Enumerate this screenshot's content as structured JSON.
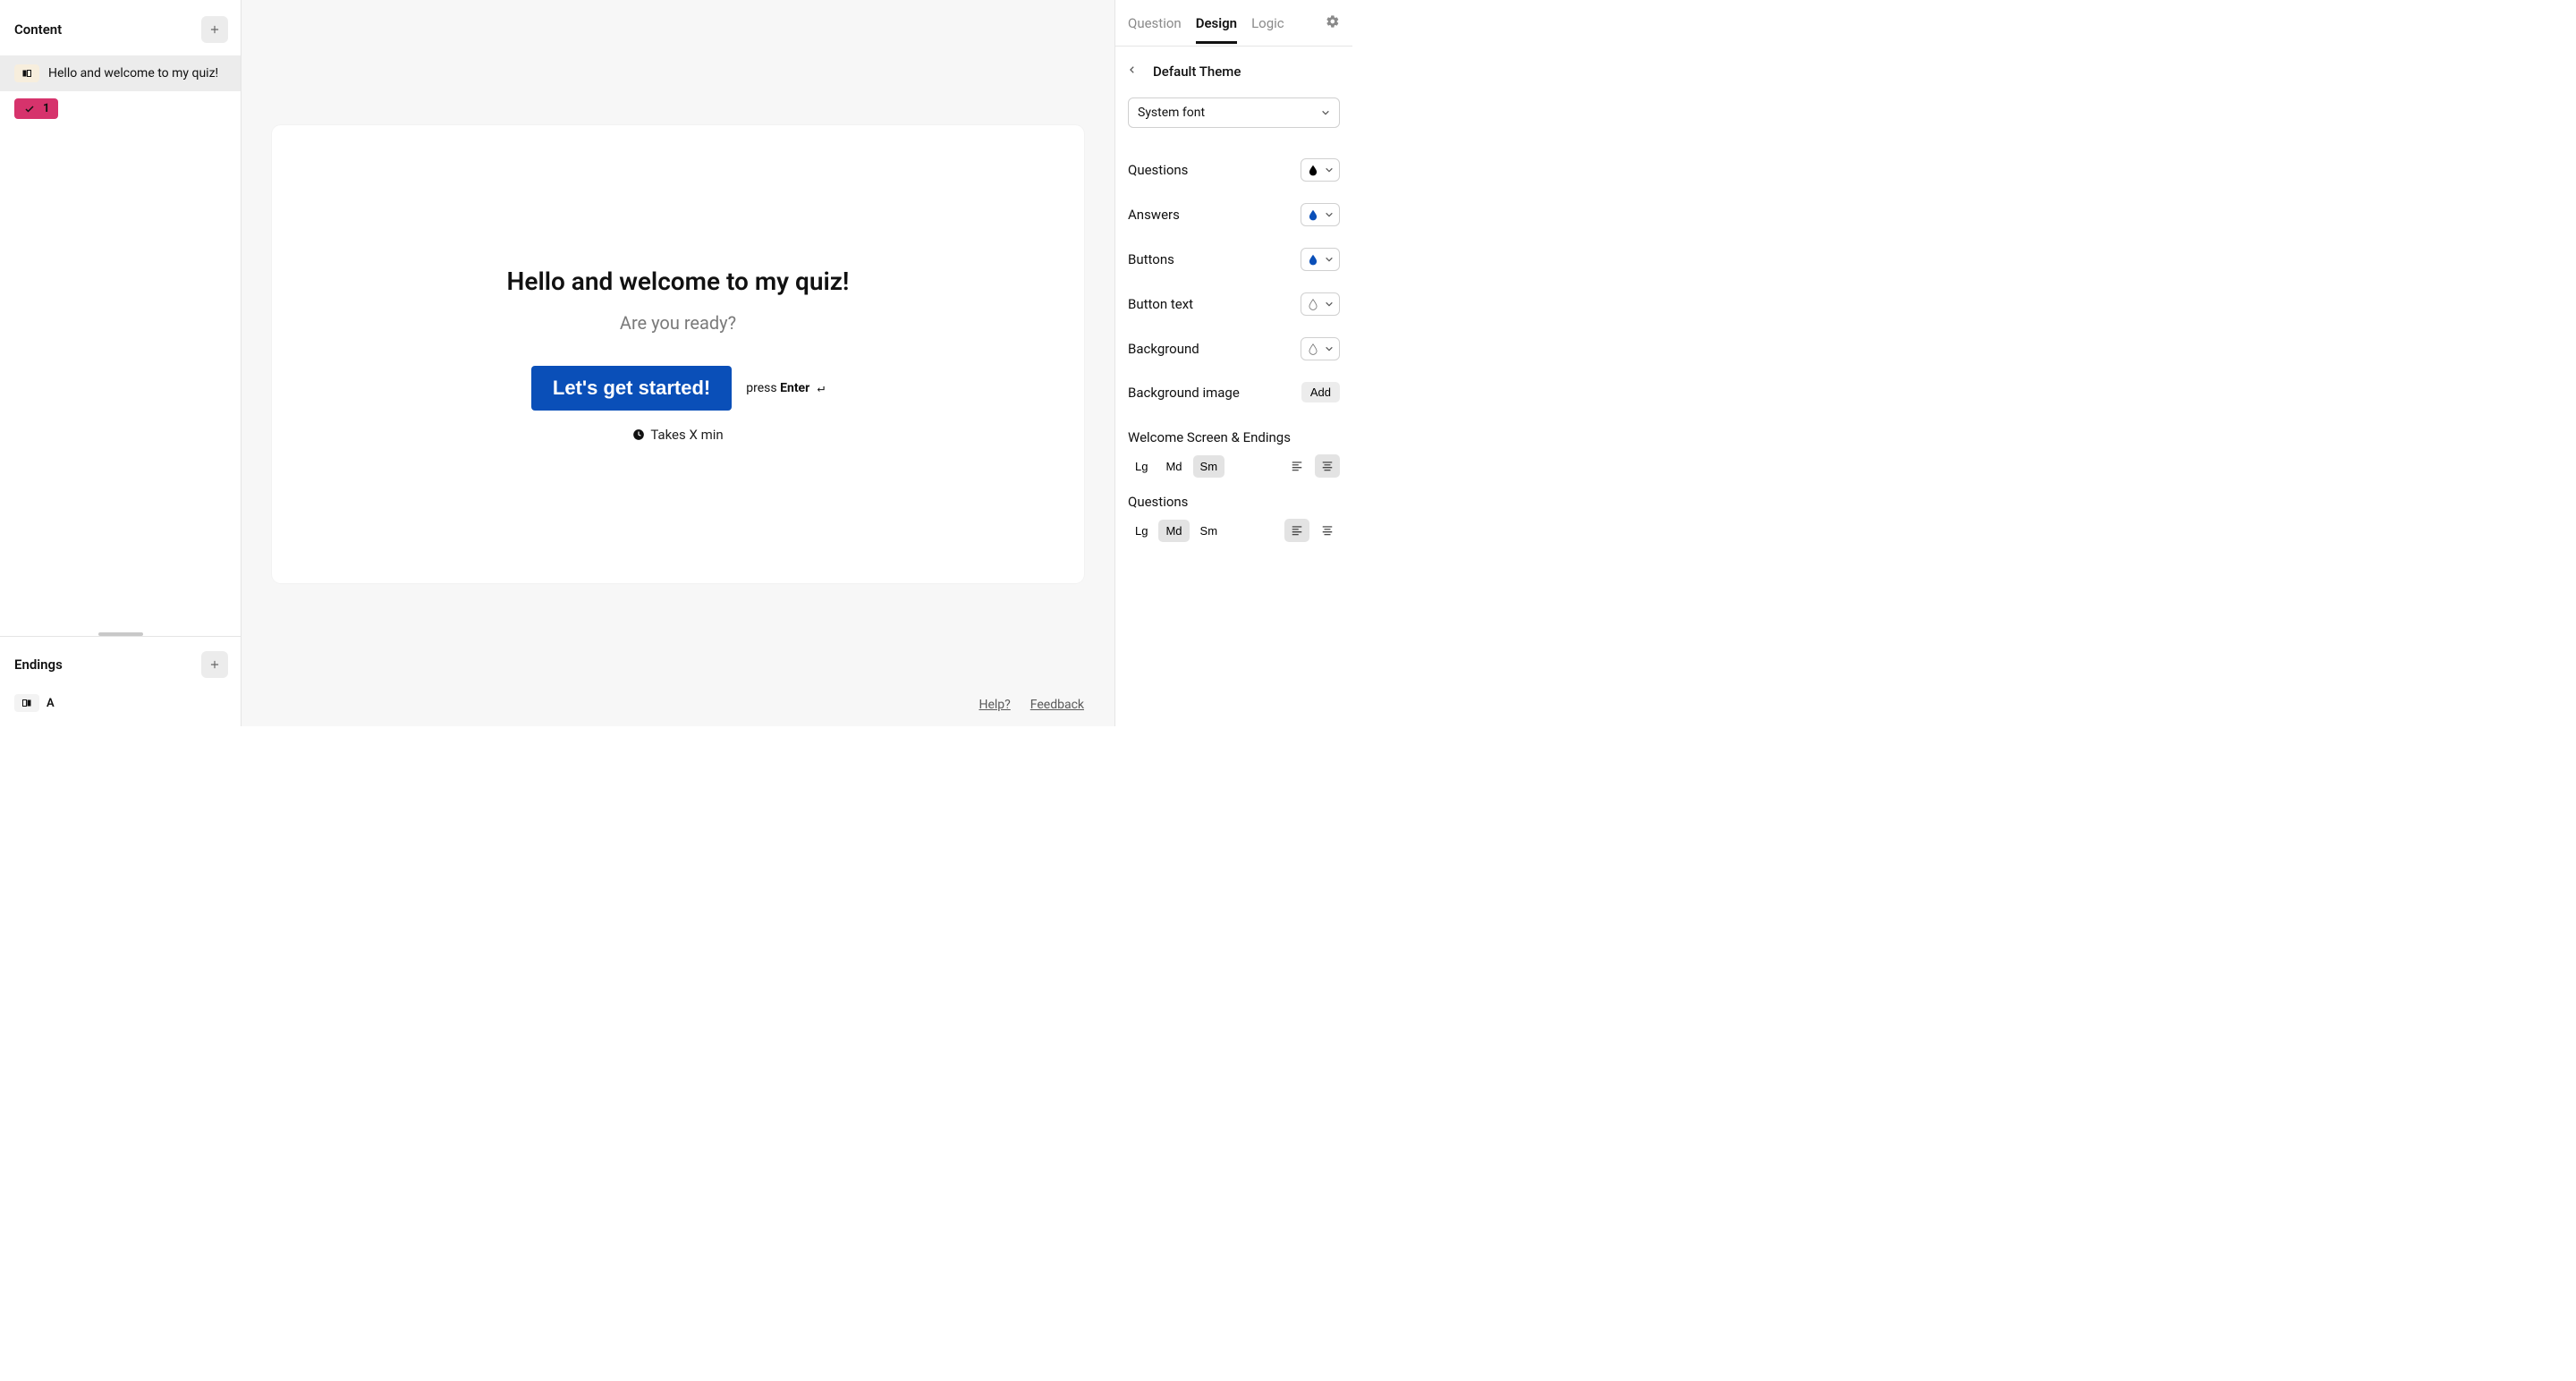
{
  "left": {
    "content_title": "Content",
    "items": [
      {
        "label": "Hello and welcome to my quiz!"
      }
    ],
    "question_badge": "1",
    "endings_title": "Endings",
    "ending_label": "A"
  },
  "canvas": {
    "title": "Hello and welcome to my quiz!",
    "subtitle": "Are you ready?",
    "cta": "Let's get started!",
    "hint_press": "press ",
    "hint_enter": "Enter",
    "hint_glyph": " ↵",
    "time_label": "Takes X min",
    "footer_help": "Help?",
    "footer_feedback": "Feedback"
  },
  "right": {
    "tabs": {
      "question": "Question",
      "design": "Design",
      "logic": "Logic"
    },
    "theme_label": "Default Theme",
    "font_select": "System font",
    "rows": {
      "questions": "Questions",
      "answers": "Answers",
      "buttons": "Buttons",
      "button_text": "Button text",
      "background": "Background",
      "bg_image": "Background image",
      "add": "Add"
    },
    "section_welcome": "Welcome Screen & Endings",
    "section_questions": "Questions",
    "sizes": {
      "lg": "Lg",
      "md": "Md",
      "sm": "Sm"
    },
    "colors": {
      "questions": "#000000",
      "answers": "#0a4fb8",
      "buttons": "#0a4fb8",
      "button_text": "none",
      "background": "none"
    }
  }
}
